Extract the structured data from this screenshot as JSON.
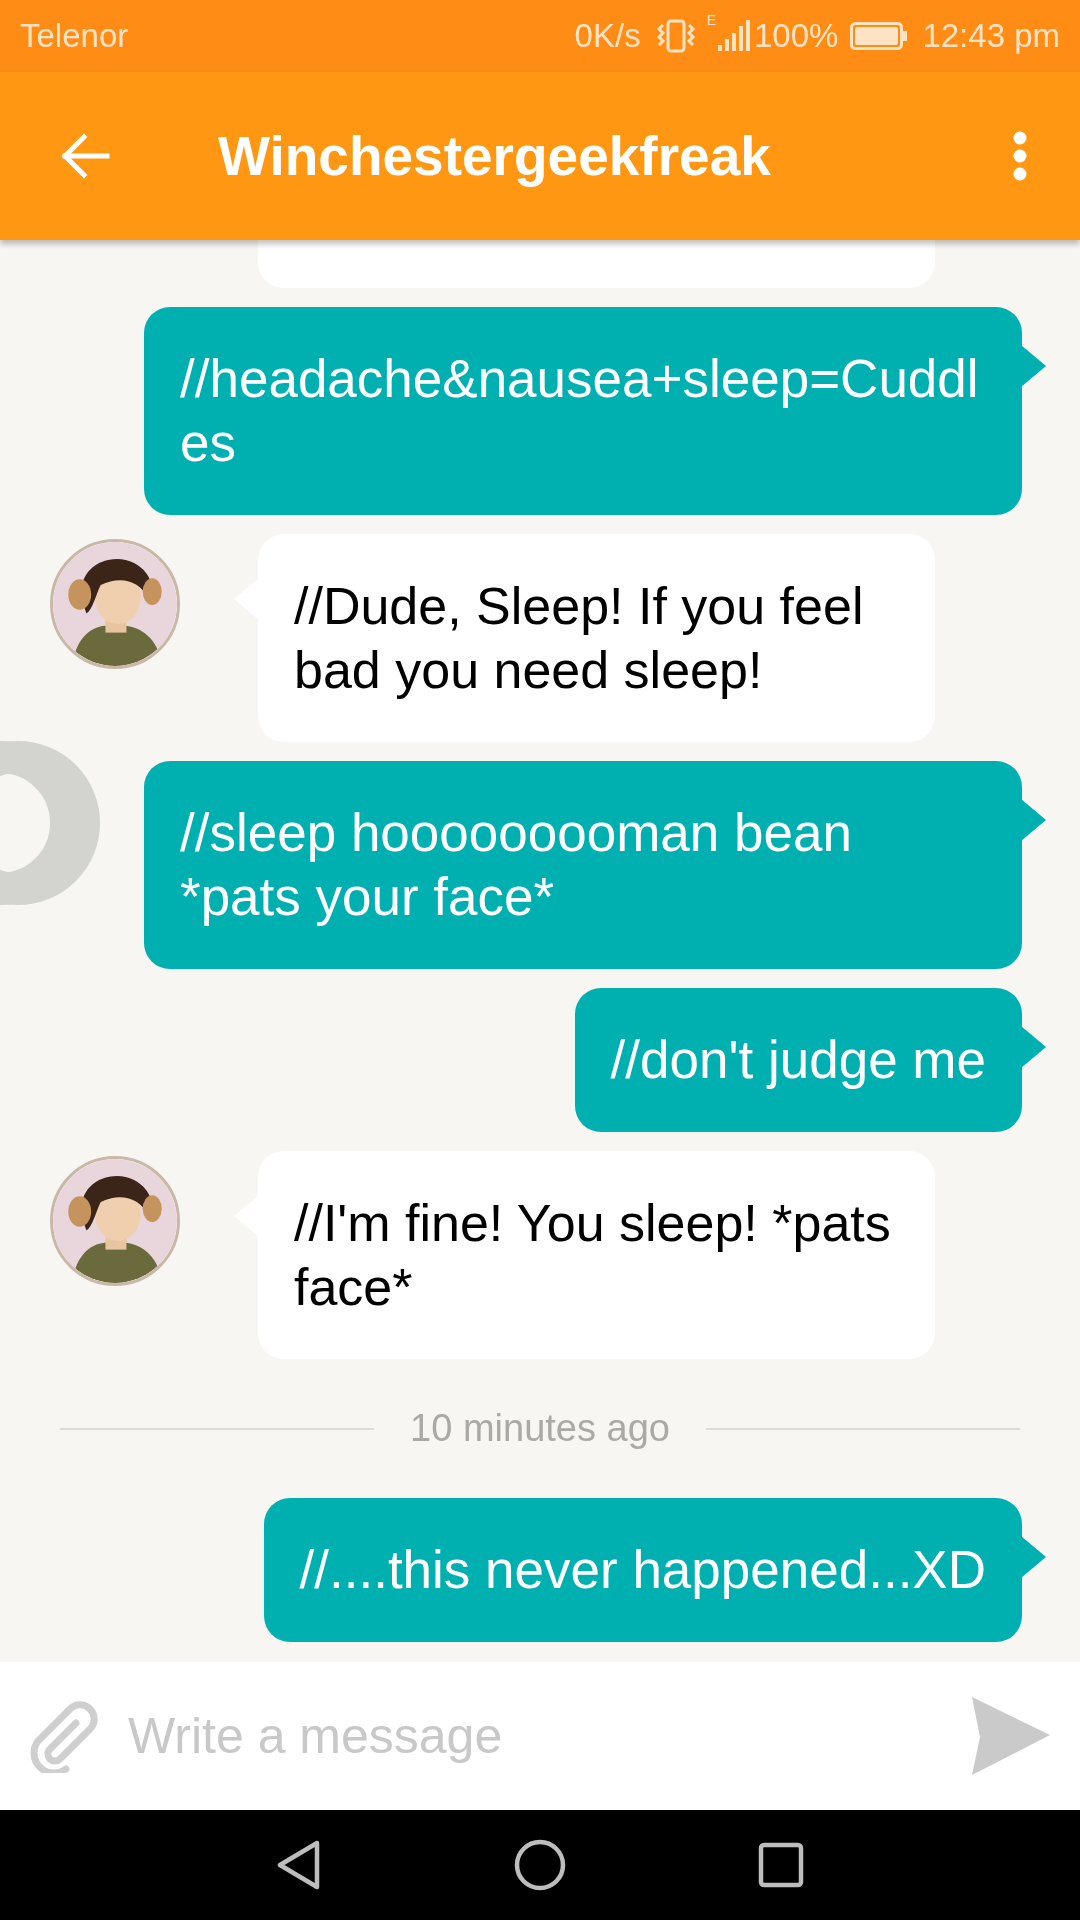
{
  "status_bar": {
    "carrier": "Telenor",
    "speed": "0K/s",
    "network": "E",
    "battery": "100%",
    "time": "12:43 pm"
  },
  "header": {
    "title": "Winchestergeekfreak"
  },
  "messages": [
    {
      "kind": "clipped"
    },
    {
      "kind": "outgoing",
      "text": "//headache&nausea+sleep=Cuddles"
    },
    {
      "kind": "incoming",
      "text": "//Dude, Sleep! If you feel bad you need sleep!"
    },
    {
      "kind": "outgoing",
      "text": "//sleep hooooooooman bean *pats your face*"
    },
    {
      "kind": "outgoing",
      "text": "//don't judge me"
    },
    {
      "kind": "incoming",
      "text": "//I'm fine! You sleep! *pats face*"
    },
    {
      "kind": "divider",
      "text": "10 minutes ago"
    },
    {
      "kind": "outgoing",
      "text": "//....this never happened...XD"
    }
  ],
  "composer": {
    "placeholder": "Write a message"
  }
}
